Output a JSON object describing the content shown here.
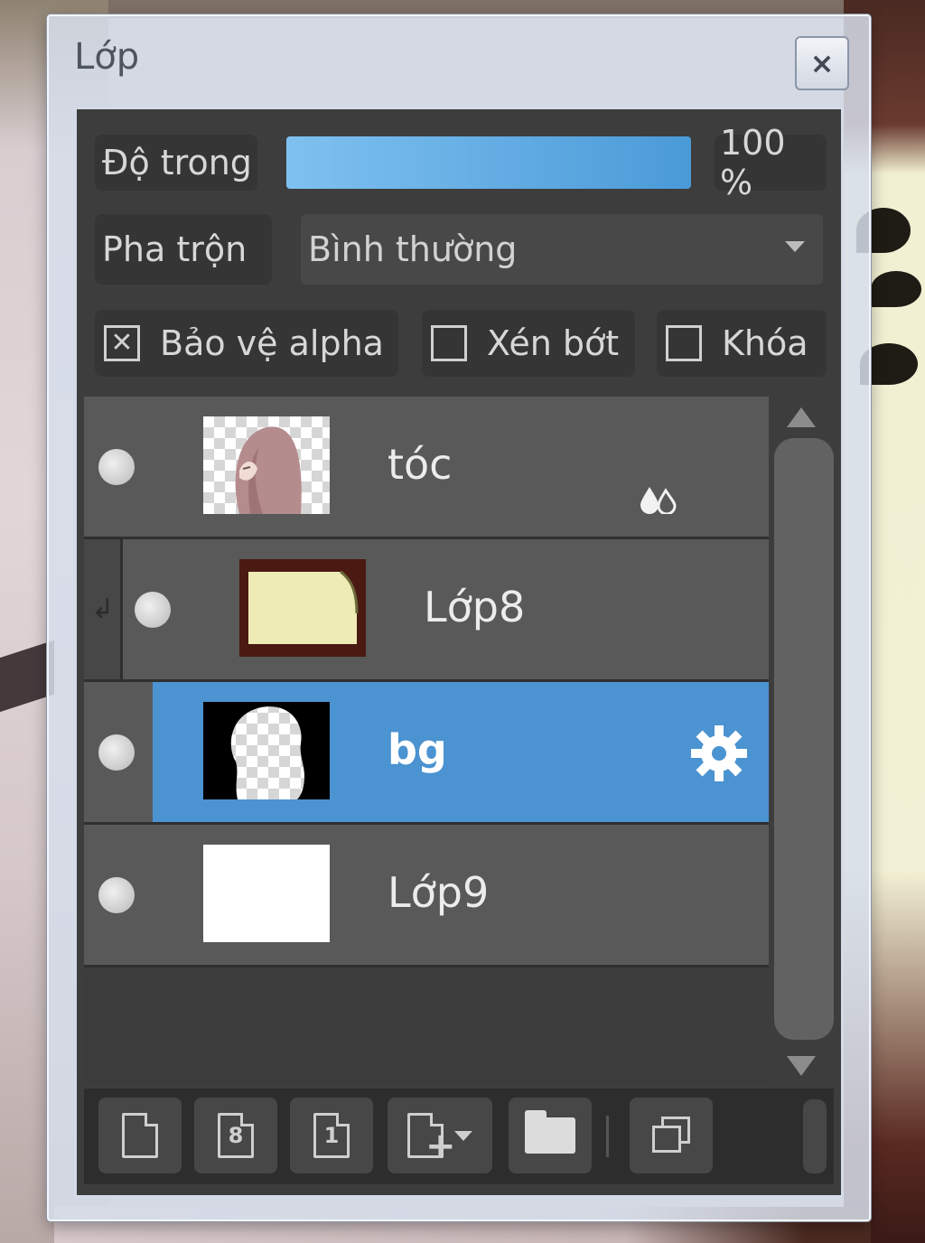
{
  "dialog": {
    "title": "Lớp",
    "close_label": "×"
  },
  "opacity": {
    "label": "Độ trong",
    "value_text": "100 %",
    "fill_fraction": 1.0
  },
  "blend": {
    "label": "Pha trộn",
    "selected": "Bình thường"
  },
  "checks": {
    "protect_alpha": {
      "label": "Bảo vệ alpha",
      "checked": true,
      "mark": "✕"
    },
    "clipping": {
      "label": "Xén bớt",
      "checked": false
    },
    "lock": {
      "label": "Khóa",
      "checked": false
    }
  },
  "layers": [
    {
      "name": "tóc",
      "thumbnail": "hair-thumbnail",
      "status_icon": "droplets-icon",
      "clipped": false,
      "selected": false
    },
    {
      "name": "Lớp8",
      "thumbnail": "cream-frame-thumbnail",
      "status_icon": "",
      "clipped": true,
      "selected": false
    },
    {
      "name": "bg",
      "thumbnail": "mask-thumbnail",
      "status_icon": "gear-icon",
      "clipped": false,
      "selected": true
    },
    {
      "name": "Lớp9",
      "thumbnail": "white-thumbnail",
      "status_icon": "",
      "clipped": false,
      "selected": false
    }
  ],
  "toolbar": {
    "buttons": [
      {
        "name": "new-layer-button",
        "icon": "new-page-icon"
      },
      {
        "name": "new-8bit-layer-button",
        "icon": "page-8-icon",
        "glyph": "8"
      },
      {
        "name": "new-1bit-layer-button",
        "icon": "page-1-icon",
        "glyph": "1"
      },
      {
        "name": "add-layer-dropdown-button",
        "icon": "page-plus-icon"
      },
      {
        "name": "new-folder-button",
        "icon": "folder-icon"
      },
      {
        "name": "duplicate-layer-button",
        "icon": "duplicate-icon"
      }
    ]
  },
  "colors": {
    "selected_row": "#4b93d1",
    "opacity_fill": "#5aa8e4",
    "panel_bg": "#3d3d3d"
  }
}
